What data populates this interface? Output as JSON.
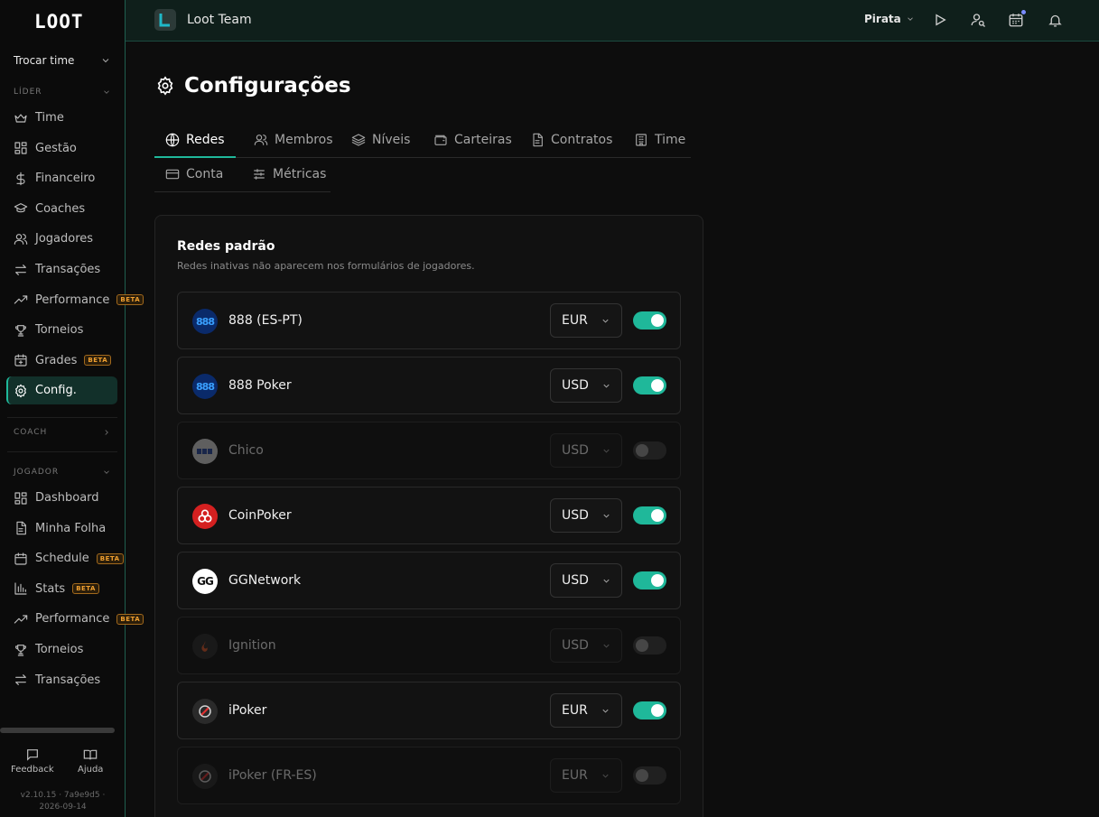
{
  "app": {
    "logo": "LOOT"
  },
  "sidebar": {
    "team_switch": "Trocar time",
    "sections": {
      "leader": "LÍDER",
      "coach": "COACH",
      "player": "JOGADOR"
    },
    "leader_items": [
      {
        "label": "Time",
        "icon": "crown-icon"
      },
      {
        "label": "Gestão",
        "icon": "grid-icon"
      },
      {
        "label": "Financeiro",
        "icon": "dollar-icon"
      },
      {
        "label": "Coaches",
        "icon": "graduation-cap-icon"
      },
      {
        "label": "Jogadores",
        "icon": "users-icon"
      },
      {
        "label": "Transações",
        "icon": "arrows-icon"
      },
      {
        "label": "Performance",
        "icon": "trending-up-icon",
        "badge": "BETA"
      },
      {
        "label": "Torneios",
        "icon": "trophy-icon"
      },
      {
        "label": "Grades",
        "icon": "calendar-plus-icon",
        "badge": "BETA"
      },
      {
        "label": "Config.",
        "icon": "gear-icon",
        "active": true
      }
    ],
    "player_items": [
      {
        "label": "Dashboard",
        "icon": "grid-icon"
      },
      {
        "label": "Minha Folha",
        "icon": "file-icon"
      },
      {
        "label": "Schedule",
        "icon": "calendar-icon",
        "badge": "BETA"
      },
      {
        "label": "Stats",
        "icon": "bar-chart-icon",
        "badge": "BETA"
      },
      {
        "label": "Performance",
        "icon": "trending-up-icon",
        "badge": "BETA"
      },
      {
        "label": "Torneios",
        "icon": "trophy-icon"
      },
      {
        "label": "Transações",
        "icon": "arrows-icon"
      }
    ],
    "footer": {
      "feedback": "Feedback",
      "help": "Ajuda"
    },
    "version": "v2.10.15 · 7a9e9d5 ·",
    "date": "2026-09-14"
  },
  "topbar": {
    "team_name": "Loot Team",
    "user": "Pirata"
  },
  "page": {
    "title": "Configurações"
  },
  "tabs": [
    {
      "label": "Redes",
      "icon": "globe-icon",
      "active": true
    },
    {
      "label": "Membros",
      "icon": "users-icon"
    },
    {
      "label": "Níveis",
      "icon": "layers-icon"
    },
    {
      "label": "Carteiras",
      "icon": "wallet-icon"
    },
    {
      "label": "Contratos",
      "icon": "document-icon"
    },
    {
      "label": "Time",
      "icon": "building-icon"
    },
    {
      "label": "Conta",
      "icon": "credit-card-icon"
    },
    {
      "label": "Métricas",
      "icon": "sliders-icon"
    }
  ],
  "networks_card": {
    "title": "Redes padrão",
    "subtitle": "Redes inativas não aparecem nos formulários de jogadores.",
    "networks": [
      {
        "name": "888 (ES-PT)",
        "currency": "EUR",
        "enabled": true,
        "logo": "888-logo",
        "logo_text": "888"
      },
      {
        "name": "888 Poker",
        "currency": "USD",
        "enabled": true,
        "logo": "888-logo",
        "logo_text": "888"
      },
      {
        "name": "Chico",
        "currency": "USD",
        "enabled": false,
        "logo": "chico-logo",
        "logo_text": ""
      },
      {
        "name": "CoinPoker",
        "currency": "USD",
        "enabled": true,
        "logo": "coinpoker-logo",
        "logo_text": ""
      },
      {
        "name": "GGNetwork",
        "currency": "USD",
        "enabled": true,
        "logo": "gg-logo",
        "logo_text": "GG"
      },
      {
        "name": "Ignition",
        "currency": "USD",
        "enabled": false,
        "logo": "ignition-logo",
        "logo_text": ""
      },
      {
        "name": "iPoker",
        "currency": "EUR",
        "enabled": true,
        "logo": "ipoker-logo",
        "logo_text": ""
      },
      {
        "name": "iPoker (FR-ES)",
        "currency": "EUR",
        "enabled": false,
        "logo": "ipoker-logo",
        "logo_text": ""
      }
    ]
  },
  "colors": {
    "accent": "#1fb89a",
    "beta": "#f0a030",
    "background": "#0d0d0d"
  }
}
